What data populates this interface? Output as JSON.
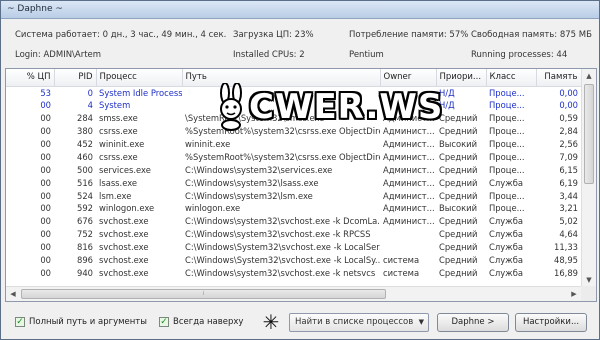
{
  "window": {
    "title": "~ Daphne ~"
  },
  "info": {
    "uptime": "Система работает: 0 дн.,  3 час., 49 мин.,  4 сек.",
    "cpu_load": "Загрузка ЦП:  23%",
    "mem_usage": "Потребление памяти:  57%",
    "free_mem": "Свободная память: 875 МБ",
    "login": "Login: ADMIN\\Artem",
    "cpus": "Installed CPUs:  2",
    "cpu_name": "Pentium",
    "running": "Running processes:   44"
  },
  "table": {
    "columns": [
      "% ЦП",
      "PID",
      "Процесс",
      "Путь",
      "Owner",
      "Приори...",
      "Класс",
      "Память"
    ],
    "rows": [
      {
        "cpu": "53",
        "pid": "0",
        "name": "System Idle Process",
        "path": "",
        "owner": "",
        "prio": "Н/Д",
        "cls": "Проце...",
        "mem": "0,00",
        "blue": true
      },
      {
        "cpu": "00",
        "pid": "4",
        "name": "System",
        "path": "",
        "owner": "",
        "prio": "Н/Д",
        "cls": "Проце...",
        "mem": "0,00",
        "blue": true
      },
      {
        "cpu": "00",
        "pid": "284",
        "name": "smss.exe",
        "path": "\\SystemRoot\\System32\\smss.exe",
        "owner": "Админист...",
        "prio": "Средний",
        "cls": "Проце...",
        "mem": "0,59"
      },
      {
        "cpu": "00",
        "pid": "380",
        "name": "csrss.exe",
        "path": "%SystemRoot%\\system32\\csrss.exe ObjectDire...",
        "owner": "Админист...",
        "prio": "Средний",
        "cls": "Проце...",
        "mem": "2,84"
      },
      {
        "cpu": "00",
        "pid": "452",
        "name": "wininit.exe",
        "path": "wininit.exe",
        "owner": "Админист...",
        "prio": "Высокий",
        "cls": "Проце...",
        "mem": "2,56"
      },
      {
        "cpu": "00",
        "pid": "460",
        "name": "csrss.exe",
        "path": "%SystemRoot%\\system32\\csrss.exe ObjectDire...",
        "owner": "Админист...",
        "prio": "Средний",
        "cls": "Проце...",
        "mem": "7,09"
      },
      {
        "cpu": "00",
        "pid": "500",
        "name": "services.exe",
        "path": "C:\\Windows\\system32\\services.exe",
        "owner": "Админист...",
        "prio": "Средний",
        "cls": "Проце...",
        "mem": "6,15"
      },
      {
        "cpu": "00",
        "pid": "516",
        "name": "lsass.exe",
        "path": "C:\\Windows\\system32\\lsass.exe",
        "owner": "Админист...",
        "prio": "Средний",
        "cls": "Служба",
        "mem": "6,19"
      },
      {
        "cpu": "00",
        "pid": "524",
        "name": "lsm.exe",
        "path": "C:\\Windows\\system32\\lsm.exe",
        "owner": "Админист...",
        "prio": "Средний",
        "cls": "Проце...",
        "mem": "3,44"
      },
      {
        "cpu": "00",
        "pid": "592",
        "name": "winlogon.exe",
        "path": "winlogon.exe",
        "owner": "Админист...",
        "prio": "Высокий",
        "cls": "Проце...",
        "mem": "3,21"
      },
      {
        "cpu": "00",
        "pid": "676",
        "name": "svchost.exe",
        "path": "C:\\Windows\\system32\\svchost.exe -k DcomLa...",
        "owner": "Админист...",
        "prio": "Средний",
        "cls": "Служба",
        "mem": "5,02"
      },
      {
        "cpu": "00",
        "pid": "752",
        "name": "svchost.exe",
        "path": "C:\\Windows\\system32\\svchost.exe -k RPCSS",
        "owner": "",
        "prio": "Средний",
        "cls": "Служба",
        "mem": "4,64"
      },
      {
        "cpu": "00",
        "pid": "816",
        "name": "svchost.exe",
        "path": "C:\\Windows\\System32\\svchost.exe -k LocalSer...",
        "owner": "",
        "prio": "Средний",
        "cls": "Служба",
        "mem": "11,33"
      },
      {
        "cpu": "00",
        "pid": "896",
        "name": "svchost.exe",
        "path": "C:\\Windows\\System32\\svchost.exe -k LocalSy...",
        "owner": "система",
        "prio": "Средний",
        "cls": "Служба",
        "mem": "48,95"
      },
      {
        "cpu": "00",
        "pid": "940",
        "name": "svchost.exe",
        "path": "C:\\Windows\\system32\\svchost.exe -k netsvcs",
        "owner": "система",
        "prio": "Средний",
        "cls": "Служба",
        "mem": "16,89"
      }
    ]
  },
  "bottom": {
    "full_path_label": "Полный путь и аргументы",
    "on_top_label": "Всегда наверху",
    "finder_icon": "crosshair-icon",
    "find_placeholder": "Найти в списке процессов",
    "daphne_button": "Daphne >",
    "settings_button": "Настройки..."
  },
  "watermark": {
    "text": "CWER.WS"
  },
  "colors": {
    "highlight_text": "#1e2fc8",
    "check": "#1a8f1a"
  }
}
